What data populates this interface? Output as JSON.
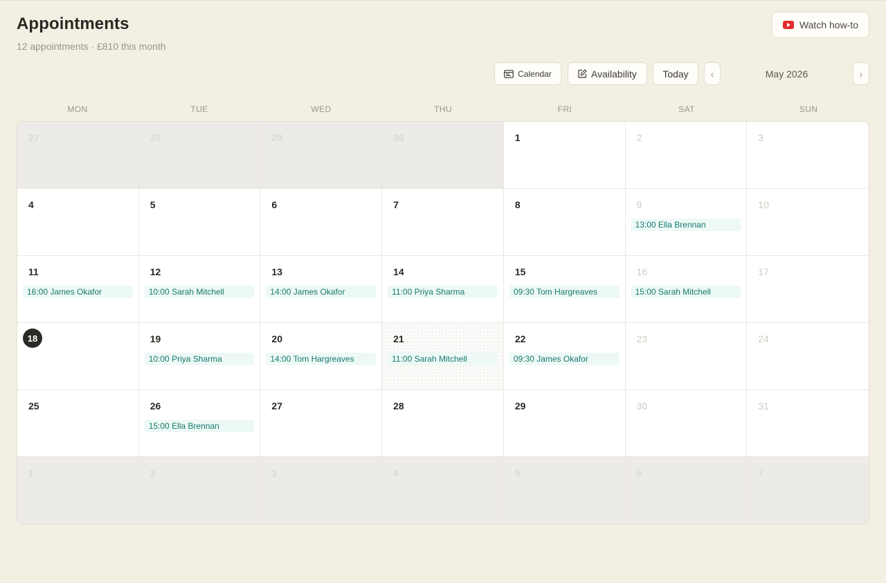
{
  "header": {
    "title": "Appointments",
    "subtitle": "12 appointments · £810 this month",
    "watch_label": "Watch how-to"
  },
  "toolbar": {
    "calendar_label": "Calendar",
    "availability_label": "Availability",
    "today_label": "Today",
    "prev_label": "‹",
    "next_label": "›",
    "month_label": "May 2026"
  },
  "weekdays": [
    "MON",
    "TUE",
    "WED",
    "THU",
    "FRI",
    "SAT",
    "SUN"
  ],
  "today_day": "18",
  "cells": [
    {
      "day": "27",
      "outside": true
    },
    {
      "day": "28",
      "outside": true
    },
    {
      "day": "29",
      "outside": true
    },
    {
      "day": "30",
      "outside": true
    },
    {
      "day": "1"
    },
    {
      "day": "2",
      "weekend": true
    },
    {
      "day": "3",
      "weekend": true
    },
    {
      "day": "4"
    },
    {
      "day": "5"
    },
    {
      "day": "6"
    },
    {
      "day": "7"
    },
    {
      "day": "8"
    },
    {
      "day": "9",
      "weekend": true,
      "event": "13:00 Ella Brennan"
    },
    {
      "day": "10",
      "weekend": true
    },
    {
      "day": "11",
      "event": "16:00 James Okafor"
    },
    {
      "day": "12",
      "event": "10:00 Sarah Mitchell"
    },
    {
      "day": "13",
      "event": "14:00 James Okafor"
    },
    {
      "day": "14",
      "event": "11:00 Priya Sharma"
    },
    {
      "day": "15",
      "event": "09:30 Tom Hargreaves"
    },
    {
      "day": "16",
      "weekend": true,
      "event": "15:00 Sarah Mitchell"
    },
    {
      "day": "17",
      "weekend": true
    },
    {
      "day": "18",
      "today": true
    },
    {
      "day": "19",
      "event": "10:00 Priya Sharma"
    },
    {
      "day": "20",
      "event": "14:00 Tom Hargreaves"
    },
    {
      "day": "21",
      "highlight": true,
      "event": "11:00 Sarah Mitchell"
    },
    {
      "day": "22",
      "event": "09:30 James Okafor"
    },
    {
      "day": "23",
      "weekend": true
    },
    {
      "day": "24",
      "weekend": true
    },
    {
      "day": "25"
    },
    {
      "day": "26",
      "event": "15:00 Ella Brennan"
    },
    {
      "day": "27"
    },
    {
      "day": "28"
    },
    {
      "day": "29"
    },
    {
      "day": "30",
      "weekend": true
    },
    {
      "day": "31",
      "weekend": true
    },
    {
      "day": "1",
      "outside": true
    },
    {
      "day": "2",
      "outside": true
    },
    {
      "day": "3",
      "outside": true
    },
    {
      "day": "4",
      "outside": true
    },
    {
      "day": "5",
      "outside": true
    },
    {
      "day": "6",
      "outside": true
    },
    {
      "day": "7",
      "outside": true
    }
  ]
}
